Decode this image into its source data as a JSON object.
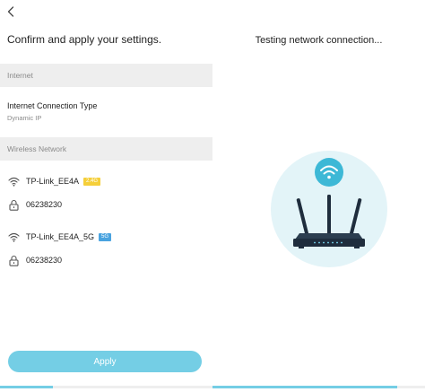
{
  "left_panel": {
    "heading": "Confirm and apply your settings.",
    "internet_section": "Internet",
    "connection_type_label": "Internet Connection Type",
    "connection_type_value": "Dynamic IP",
    "wireless_section": "Wireless Network",
    "networks": [
      {
        "ssid": "TP-Link_EE4A",
        "band": "2.4G",
        "band_color": "#f5cf3a",
        "password": "06238230"
      },
      {
        "ssid": "TP-Link_EE4A_5G",
        "band": "5G",
        "band_color": "#4aa3df",
        "password": "06238230"
      }
    ],
    "apply_label": "Apply",
    "progress_fraction": 0.25
  },
  "right_panel": {
    "status_text": "Testing network connection...",
    "progress_fraction": 0.87
  },
  "icons": {
    "back": "chevron-left-icon",
    "wifi": "wifi-icon",
    "lock": "lock-icon",
    "router": "router-icon"
  },
  "colors": {
    "accent": "#74cee5",
    "illustration_bg": "#e3f4f8",
    "wifi_circle": "#3db8d6",
    "router_body": "#1f2d3d"
  }
}
